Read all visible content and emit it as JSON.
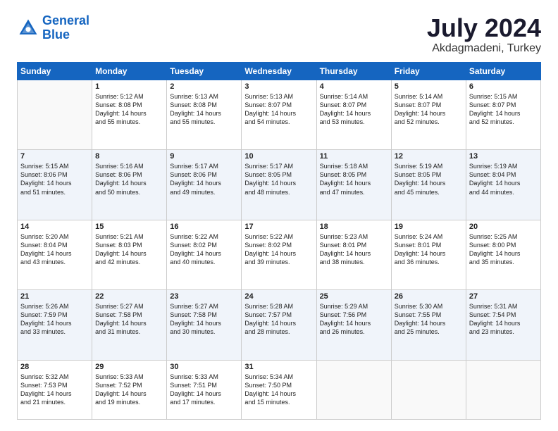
{
  "logo": {
    "line1": "General",
    "line2": "Blue"
  },
  "title": "July 2024",
  "subtitle": "Akdagmadeni, Turkey",
  "weekdays": [
    "Sunday",
    "Monday",
    "Tuesday",
    "Wednesday",
    "Thursday",
    "Friday",
    "Saturday"
  ],
  "weeks": [
    [
      {
        "day": "",
        "info": ""
      },
      {
        "day": "1",
        "info": "Sunrise: 5:12 AM\nSunset: 8:08 PM\nDaylight: 14 hours\nand 55 minutes."
      },
      {
        "day": "2",
        "info": "Sunrise: 5:13 AM\nSunset: 8:08 PM\nDaylight: 14 hours\nand 55 minutes."
      },
      {
        "day": "3",
        "info": "Sunrise: 5:13 AM\nSunset: 8:07 PM\nDaylight: 14 hours\nand 54 minutes."
      },
      {
        "day": "4",
        "info": "Sunrise: 5:14 AM\nSunset: 8:07 PM\nDaylight: 14 hours\nand 53 minutes."
      },
      {
        "day": "5",
        "info": "Sunrise: 5:14 AM\nSunset: 8:07 PM\nDaylight: 14 hours\nand 52 minutes."
      },
      {
        "day": "6",
        "info": "Sunrise: 5:15 AM\nSunset: 8:07 PM\nDaylight: 14 hours\nand 52 minutes."
      }
    ],
    [
      {
        "day": "7",
        "info": "Sunrise: 5:15 AM\nSunset: 8:06 PM\nDaylight: 14 hours\nand 51 minutes."
      },
      {
        "day": "8",
        "info": "Sunrise: 5:16 AM\nSunset: 8:06 PM\nDaylight: 14 hours\nand 50 minutes."
      },
      {
        "day": "9",
        "info": "Sunrise: 5:17 AM\nSunset: 8:06 PM\nDaylight: 14 hours\nand 49 minutes."
      },
      {
        "day": "10",
        "info": "Sunrise: 5:17 AM\nSunset: 8:05 PM\nDaylight: 14 hours\nand 48 minutes."
      },
      {
        "day": "11",
        "info": "Sunrise: 5:18 AM\nSunset: 8:05 PM\nDaylight: 14 hours\nand 47 minutes."
      },
      {
        "day": "12",
        "info": "Sunrise: 5:19 AM\nSunset: 8:05 PM\nDaylight: 14 hours\nand 45 minutes."
      },
      {
        "day": "13",
        "info": "Sunrise: 5:19 AM\nSunset: 8:04 PM\nDaylight: 14 hours\nand 44 minutes."
      }
    ],
    [
      {
        "day": "14",
        "info": "Sunrise: 5:20 AM\nSunset: 8:04 PM\nDaylight: 14 hours\nand 43 minutes."
      },
      {
        "day": "15",
        "info": "Sunrise: 5:21 AM\nSunset: 8:03 PM\nDaylight: 14 hours\nand 42 minutes."
      },
      {
        "day": "16",
        "info": "Sunrise: 5:22 AM\nSunset: 8:02 PM\nDaylight: 14 hours\nand 40 minutes."
      },
      {
        "day": "17",
        "info": "Sunrise: 5:22 AM\nSunset: 8:02 PM\nDaylight: 14 hours\nand 39 minutes."
      },
      {
        "day": "18",
        "info": "Sunrise: 5:23 AM\nSunset: 8:01 PM\nDaylight: 14 hours\nand 38 minutes."
      },
      {
        "day": "19",
        "info": "Sunrise: 5:24 AM\nSunset: 8:01 PM\nDaylight: 14 hours\nand 36 minutes."
      },
      {
        "day": "20",
        "info": "Sunrise: 5:25 AM\nSunset: 8:00 PM\nDaylight: 14 hours\nand 35 minutes."
      }
    ],
    [
      {
        "day": "21",
        "info": "Sunrise: 5:26 AM\nSunset: 7:59 PM\nDaylight: 14 hours\nand 33 minutes."
      },
      {
        "day": "22",
        "info": "Sunrise: 5:27 AM\nSunset: 7:58 PM\nDaylight: 14 hours\nand 31 minutes."
      },
      {
        "day": "23",
        "info": "Sunrise: 5:27 AM\nSunset: 7:58 PM\nDaylight: 14 hours\nand 30 minutes."
      },
      {
        "day": "24",
        "info": "Sunrise: 5:28 AM\nSunset: 7:57 PM\nDaylight: 14 hours\nand 28 minutes."
      },
      {
        "day": "25",
        "info": "Sunrise: 5:29 AM\nSunset: 7:56 PM\nDaylight: 14 hours\nand 26 minutes."
      },
      {
        "day": "26",
        "info": "Sunrise: 5:30 AM\nSunset: 7:55 PM\nDaylight: 14 hours\nand 25 minutes."
      },
      {
        "day": "27",
        "info": "Sunrise: 5:31 AM\nSunset: 7:54 PM\nDaylight: 14 hours\nand 23 minutes."
      }
    ],
    [
      {
        "day": "28",
        "info": "Sunrise: 5:32 AM\nSunset: 7:53 PM\nDaylight: 14 hours\nand 21 minutes."
      },
      {
        "day": "29",
        "info": "Sunrise: 5:33 AM\nSunset: 7:52 PM\nDaylight: 14 hours\nand 19 minutes."
      },
      {
        "day": "30",
        "info": "Sunrise: 5:33 AM\nSunset: 7:51 PM\nDaylight: 14 hours\nand 17 minutes."
      },
      {
        "day": "31",
        "info": "Sunrise: 5:34 AM\nSunset: 7:50 PM\nDaylight: 14 hours\nand 15 minutes."
      },
      {
        "day": "",
        "info": ""
      },
      {
        "day": "",
        "info": ""
      },
      {
        "day": "",
        "info": ""
      }
    ]
  ]
}
